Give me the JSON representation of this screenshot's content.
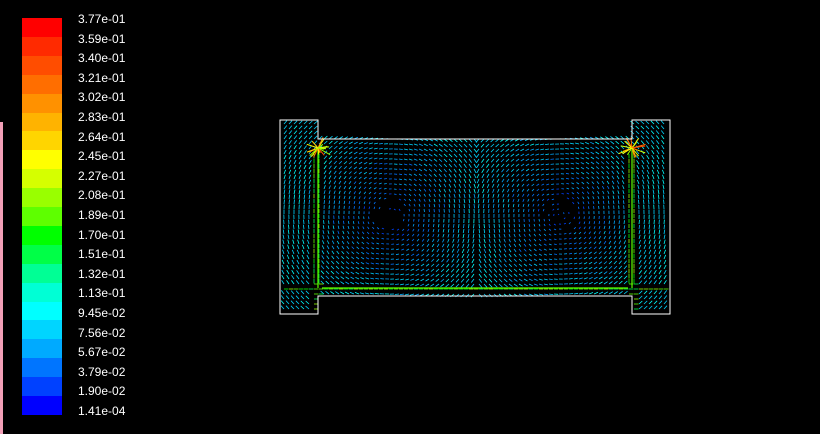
{
  "legend": {
    "levels": [
      {
        "label": "3.77e-01",
        "color": "#ff0000"
      },
      {
        "label": "3.59e-01",
        "color": "#ff2a00"
      },
      {
        "label": "3.40e-01",
        "color": "#ff4d00"
      },
      {
        "label": "3.21e-01",
        "color": "#ff6e00"
      },
      {
        "label": "3.02e-01",
        "color": "#ff9100"
      },
      {
        "label": "2.83e-01",
        "color": "#ffb300"
      },
      {
        "label": "2.64e-01",
        "color": "#ffd500"
      },
      {
        "label": "2.45e-01",
        "color": "#ffff00"
      },
      {
        "label": "2.27e-01",
        "color": "#d5ff00"
      },
      {
        "label": "2.08e-01",
        "color": "#99ff00"
      },
      {
        "label": "1.89e-01",
        "color": "#5eff00"
      },
      {
        "label": "1.70e-01",
        "color": "#00ff00"
      },
      {
        "label": "1.51e-01",
        "color": "#00ff47"
      },
      {
        "label": "1.32e-01",
        "color": "#00ff95"
      },
      {
        "label": "1.13e-01",
        "color": "#00ffd5"
      },
      {
        "label": "9.45e-02",
        "color": "#00ffff"
      },
      {
        "label": "7.56e-02",
        "color": "#00d5ff"
      },
      {
        "label": "5.67e-02",
        "color": "#00aaff"
      },
      {
        "label": "3.79e-02",
        "color": "#0075ff"
      },
      {
        "label": "1.90e-02",
        "color": "#0041ff"
      },
      {
        "label": "1.41e-04",
        "color": "#0000ff"
      }
    ]
  },
  "colors": {
    "background": "#000000",
    "outline": "#ffffff"
  }
}
